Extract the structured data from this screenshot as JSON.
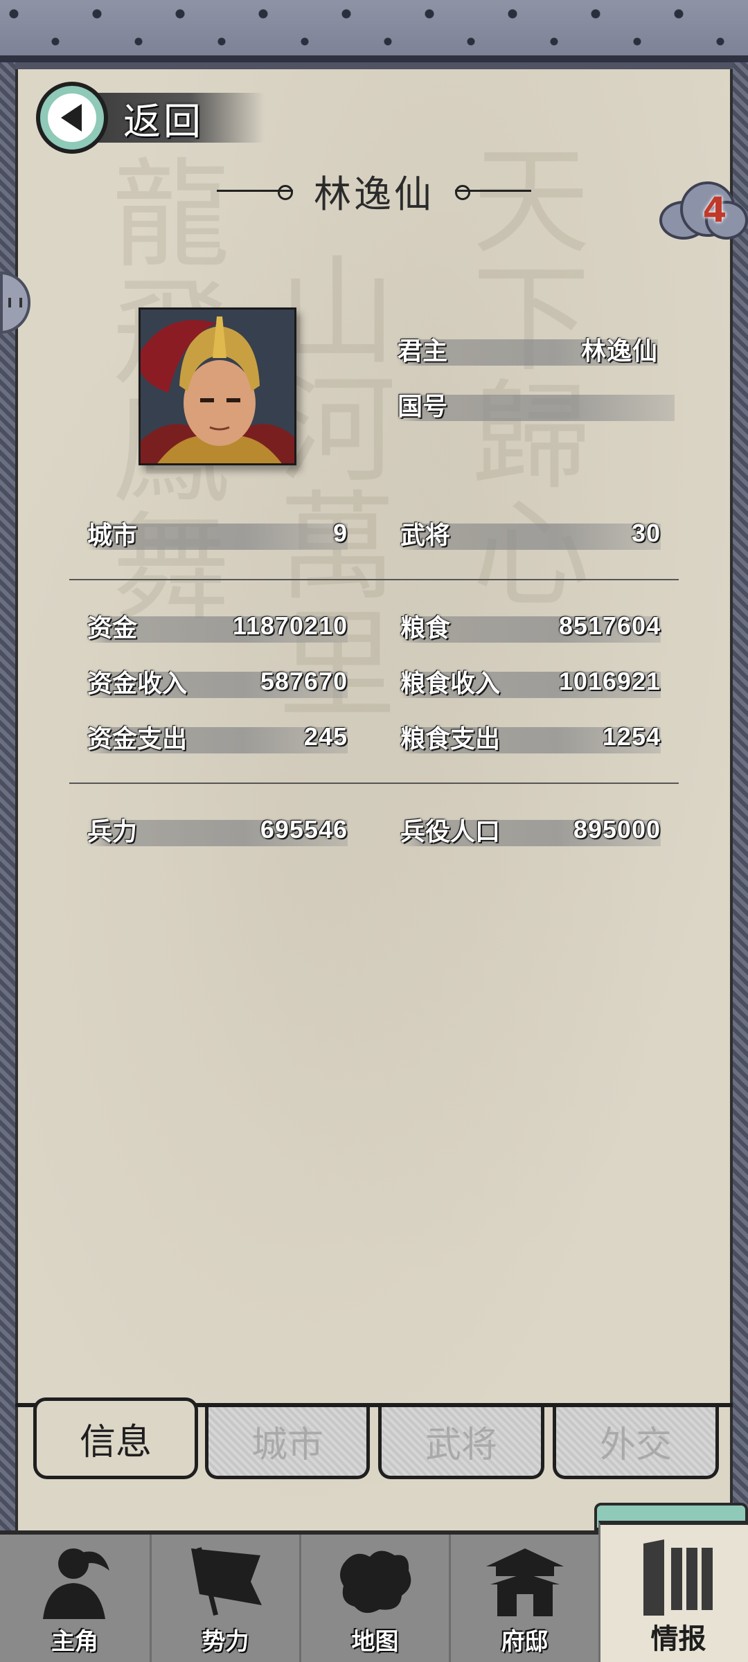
{
  "header": {
    "back_label": "返回",
    "title": "林逸仙",
    "badge_count": "4"
  },
  "ruler": {
    "lord_label": "君主",
    "lord_value": "林逸仙",
    "nation_label": "国号",
    "nation_value": ""
  },
  "stats": {
    "cities": {
      "label": "城市",
      "value": "9"
    },
    "generals": {
      "label": "武将",
      "value": "30"
    },
    "funds": {
      "label": "资金",
      "value": "11870210"
    },
    "grain": {
      "label": "粮食",
      "value": "8517604"
    },
    "funds_income": {
      "label": "资金收入",
      "value": "587670"
    },
    "grain_income": {
      "label": "粮食收入",
      "value": "1016921"
    },
    "funds_expense": {
      "label": "资金支出",
      "value": "245"
    },
    "grain_expense": {
      "label": "粮食支出",
      "value": "1254"
    },
    "troops": {
      "label": "兵力",
      "value": "695546"
    },
    "conscript_pop": {
      "label": "兵役人口",
      "value": "895000"
    }
  },
  "tabs": [
    {
      "label": "信息",
      "active": true
    },
    {
      "label": "城市",
      "active": false
    },
    {
      "label": "武将",
      "active": false
    },
    {
      "label": "外交",
      "active": false
    }
  ],
  "nav": [
    {
      "label": "主角",
      "icon": "warrior-icon"
    },
    {
      "label": "势力",
      "icon": "flag-icon"
    },
    {
      "label": "地图",
      "icon": "map-icon"
    },
    {
      "label": "府邸",
      "icon": "mansion-icon"
    },
    {
      "label": "情报",
      "icon": "scroll-icon",
      "active": true
    }
  ],
  "colors": {
    "paper": "#dcd6c7",
    "accent_teal": "#8fc9b8",
    "badge_red": "#c0392b",
    "frame": "#4f5363"
  }
}
